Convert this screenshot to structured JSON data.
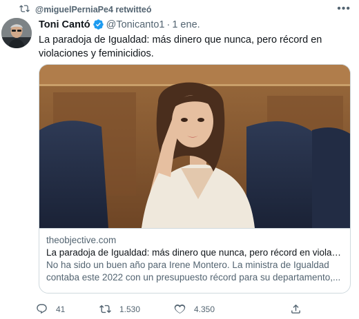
{
  "retweet": {
    "label": "@miguelPerniaPe4 retwitteó"
  },
  "tweet": {
    "name": "Toni Cantó",
    "handle": "@Tonicanto1",
    "separator": "·",
    "date": "1 ene.",
    "text": "La paradoja de Igualdad: más dinero que nunca, pero récord en violaciones y feminicidios."
  },
  "card": {
    "domain": "theobjective.com",
    "title": "La paradoja de Igualdad: más dinero que nunca, pero récord en violaci...",
    "description": "No ha sido un buen año para Irene Montero. La ministra de Igualdad contaba este 2022 con un presupuesto récord para su departamento,..."
  },
  "actions": {
    "replies": "41",
    "retweets": "1.530",
    "likes": "4.350"
  },
  "icons": {
    "retweet": "retweet-icon",
    "verified": "verified-badge-icon",
    "more": "more-options-icon",
    "reply": "reply-icon",
    "like": "heart-icon",
    "share": "share-icon"
  },
  "colors": {
    "verified": "#1d9bf0",
    "secondary_text": "#536471",
    "primary_text": "#0f1419",
    "border": "#cfd9de"
  }
}
